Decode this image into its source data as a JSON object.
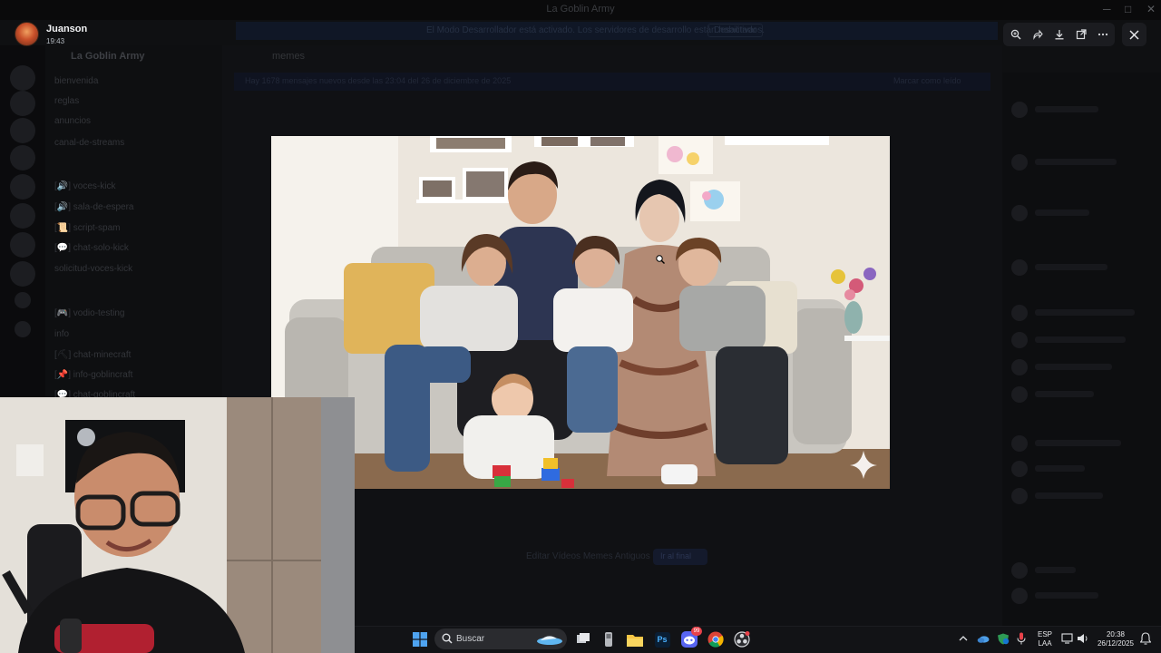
{
  "window": {
    "title": "La Goblin Army"
  },
  "banner": {
    "text": "El Modo Desarrollador está activado. Los servidores de desarrollo están habilitados.",
    "button_label": "Desactivar"
  },
  "server": {
    "name": "La Goblin Army"
  },
  "channels": [
    {
      "label": "bienvenida"
    },
    {
      "label": "reglas"
    },
    {
      "label": "anuncios"
    },
    {
      "label": "canal-de-streams"
    },
    {
      "label": "[🔊] voces-kick"
    },
    {
      "label": "[🔊] sala-de-espera"
    },
    {
      "label": "[📜] script-spam"
    },
    {
      "label": "[💬] chat-solo-kick"
    },
    {
      "label": "solicitud-voces-kick"
    },
    {
      "label": "[🎮] vodio-testing"
    },
    {
      "label": "info"
    },
    {
      "label": "[⛏] chat-minecraft"
    },
    {
      "label": "[📌] info-goblincraft"
    },
    {
      "label": "[💬] chat-goblincraft"
    }
  ],
  "chat": {
    "channel_name": "memes",
    "notice": "Hay 1678 mensajes nuevos desde las 23:04 del 26 de diciembre de 2025",
    "notice_action": "Marcar como leído",
    "bottom_message": "Editar Vídeos Memes Antiguos",
    "bottom_action": "Ir al final"
  },
  "viewer": {
    "uploader_name": "Juanson",
    "upload_time": "19:43",
    "tools": [
      {
        "name": "zoom-icon"
      },
      {
        "name": "forward-icon"
      },
      {
        "name": "download-icon"
      },
      {
        "name": "open-external-icon"
      },
      {
        "name": "more-icon"
      }
    ],
    "close": "close-icon"
  },
  "taskbar": {
    "search_placeholder": "Buscar",
    "apps": [
      "windows-start-icon",
      "task-view-icon",
      "file-explorer-icon",
      "photoshop-icon",
      "discord-icon",
      "chrome-icon",
      "obs-icon"
    ],
    "photoshop_label": "Ps",
    "discord_badge": "99",
    "language_line1": "ESP",
    "language_line2": "LAA",
    "clock_time": "20:38",
    "clock_date": "26/12/2025"
  },
  "colors": {
    "accent": "#5865f2",
    "background": "#0b0c0e",
    "taskbar": "#121316"
  }
}
